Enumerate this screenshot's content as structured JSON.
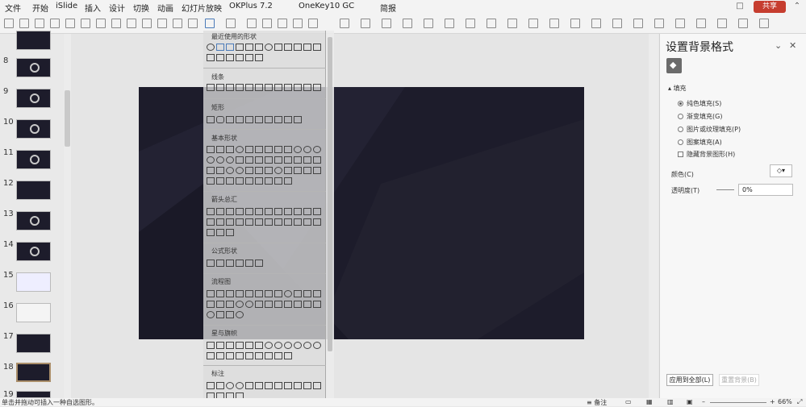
{
  "menubar": {
    "items": [
      "文件",
      "开始",
      "iSlide",
      "插入",
      "设计",
      "切换",
      "动画",
      "幻灯片放映",
      "OKPlus 7.2",
      "OneKey10 GC",
      "简报"
    ],
    "share_label": "共享"
  },
  "slides": {
    "numbers": [
      "8",
      "9",
      "10",
      "11",
      "12",
      "13",
      "14",
      "15",
      "16",
      "17",
      "18",
      "19"
    ]
  },
  "shapes_panel": {
    "categories": [
      "最近使用的形状",
      "线条",
      "矩形",
      "基本形状",
      "箭头总汇",
      "公式形状",
      "流程图",
      "星与旗帜",
      "标注"
    ]
  },
  "format_pane": {
    "title": "设置背景格式",
    "section": "填充",
    "options": [
      "纯色填充(S)",
      "渐变填充(G)",
      "图片或纹理填充(P)",
      "图案填充(A)"
    ],
    "hide_bg_label": "隐藏背景图形(H)",
    "color_label": "颜色(C)",
    "transparency_label": "透明度(T)",
    "transparency_value": "0%",
    "apply_all": "应用到全部(L)",
    "reset_bg": "重置背景(B)"
  },
  "statusbar": {
    "hint": "单击并拖动可插入一种自选图形。",
    "notes": "备注",
    "zoom": "66%"
  },
  "colors": {
    "slide_bg": "#1d1c2b",
    "accent": "#c63d2f"
  }
}
